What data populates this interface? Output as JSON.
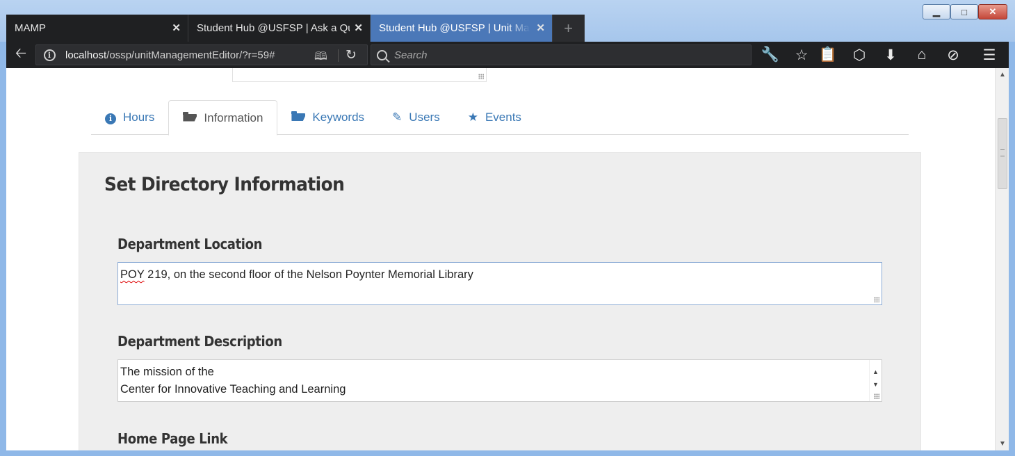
{
  "browser": {
    "tabs": [
      {
        "title": "MAMP",
        "active": false
      },
      {
        "title": "Student Hub @USFSP | Ask a Question",
        "active": false
      },
      {
        "title": "Student Hub @USFSP | Unit Management",
        "active": true
      }
    ],
    "new_tab_label": "+",
    "url": {
      "host": "localhost",
      "path": "/ossp/unitManagementEditor/?r=59#"
    },
    "search_placeholder": "Search",
    "window_controls": {
      "minimize": "▁",
      "maximize": "□",
      "close": "✕"
    }
  },
  "page": {
    "tabs": [
      {
        "label": "Hours",
        "icon": "info-circle-icon",
        "active": false
      },
      {
        "label": "Information",
        "icon": "folder-open-icon",
        "active": true
      },
      {
        "label": "Keywords",
        "icon": "folder-open-icon",
        "active": false
      },
      {
        "label": "Users",
        "icon": "pencil-icon",
        "active": false
      },
      {
        "label": "Events",
        "icon": "star-icon",
        "active": false
      }
    ],
    "panel_title": "Set Directory Information",
    "fields": {
      "location": {
        "label": "Department Location",
        "value_part1": "POY",
        "value_part2": " 2",
        "value_part3": "19, on the second floor of the Nelson Poynter Memorial Library"
      },
      "description": {
        "label": "Department Description",
        "line1": "The mission of the",
        "line2": "Center for Innovative Teaching and Learning"
      },
      "homepage": {
        "label": "Home Page Link"
      }
    }
  }
}
